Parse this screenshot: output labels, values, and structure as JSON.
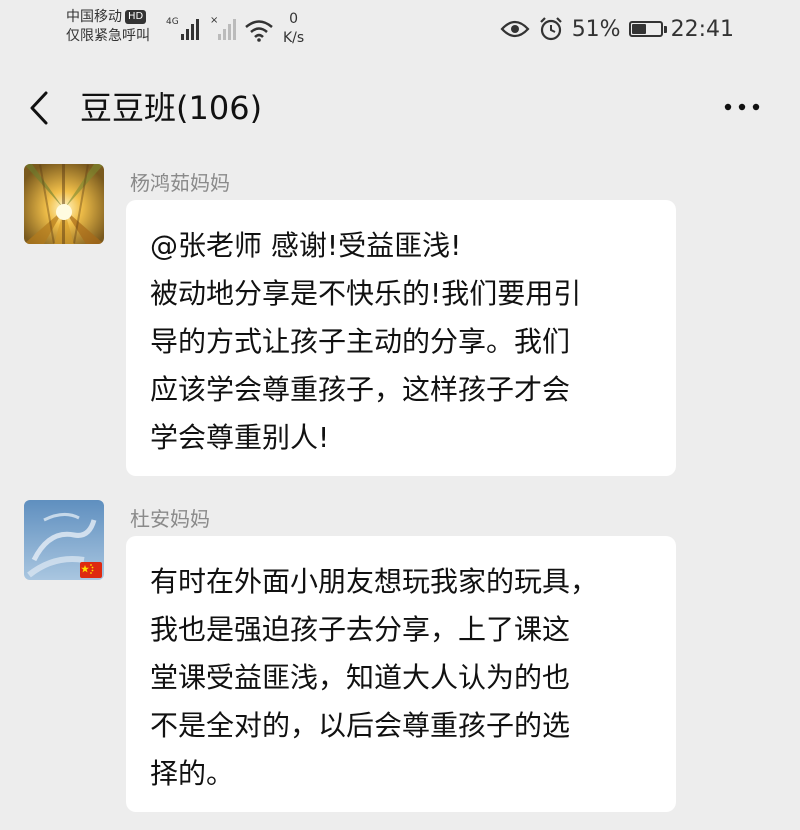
{
  "status_bar": {
    "carrier_line1": "中国移动",
    "hd_badge": "HD",
    "carrier_line2": "仅限紧急呼叫",
    "network": "4G",
    "speed_value": "0",
    "speed_unit": "K/s",
    "battery_percent": "51%",
    "battery_level": 0.51,
    "time": "22:41"
  },
  "header": {
    "title": "豆豆班(106)"
  },
  "messages": [
    {
      "sender": "杨鸿茹妈妈",
      "lines": [
        "@张老师  感谢!受益匪浅!",
        "被动地分享是不快乐的!我们要用引",
        "导的方式让孩子主动的分享。我们",
        "应该学会尊重孩子，这样孩子才会",
        "学会尊重别人!"
      ]
    },
    {
      "sender": "杜安妈妈",
      "lines": [
        "有时在外面小朋友想玩我家的玩具，",
        "我也是强迫孩子去分享，上了课这",
        "堂课受益匪浅，知道大人认为的也",
        "不是全对的，以后会尊重孩子的选",
        "择的。"
      ]
    }
  ],
  "icons": [
    "back-arrow-icon",
    "more-options-icon",
    "eye-icon",
    "alarm-icon",
    "battery-icon",
    "signal-icon",
    "wifi-icon",
    "china-flag-icon"
  ],
  "colors": {
    "background": "#ededed",
    "bubble": "#ffffff",
    "sender_name": "#8a8a8a",
    "text": "#111111"
  }
}
